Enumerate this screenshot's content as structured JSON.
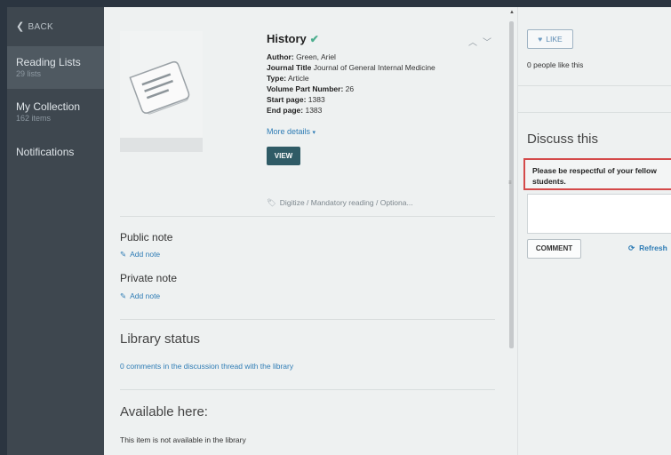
{
  "sidebar": {
    "back_label": "BACK",
    "items": [
      {
        "label": "Reading Lists",
        "sub": "29 lists"
      },
      {
        "label": "My Collection",
        "sub": "162 items"
      },
      {
        "label": "Notifications",
        "sub": ""
      }
    ]
  },
  "item": {
    "title": "History",
    "author_label": "Author:",
    "author": "Green, Ariel",
    "journal_label": "Journal Title",
    "journal": "Journal of General Internal Medicine",
    "type_label": "Type:",
    "type": "Article",
    "volume_label": "Volume Part Number:",
    "volume": "26",
    "start_label": "Start page:",
    "start": "1383",
    "end_label": "End page:",
    "end": "1383",
    "more_details": "More details",
    "view_button": "VIEW",
    "tags": "Digitize / Mandatory reading / Optiona..."
  },
  "notes": {
    "public_label": "Public note",
    "public_add": "Add note",
    "private_label": "Private note",
    "private_add": "Add note"
  },
  "library": {
    "status_heading": "Library status",
    "comments_link": "0 comments in the discussion thread with the library",
    "available_heading": "Available here:",
    "availability": "This item is not available in the library"
  },
  "right": {
    "like_button": "LIKE",
    "likes_count": "0 people like this",
    "discuss_title": "Discuss this",
    "warning": "Please be respectful of your fellow students.",
    "comment_button": "COMMENT",
    "refresh": "Refresh"
  },
  "icons": [
    "back-chevron-icon",
    "check-icon",
    "chevron-up-icon",
    "chevron-down-icon",
    "document-icon",
    "tag-icon",
    "pencil-icon",
    "heart-icon",
    "refresh-icon"
  ],
  "colors": {
    "sidebar": "#3e474f",
    "link": "#2e7cb5",
    "view_button": "#2f5b66",
    "warning_border": "#d44a4a",
    "check": "#4cae8e"
  }
}
